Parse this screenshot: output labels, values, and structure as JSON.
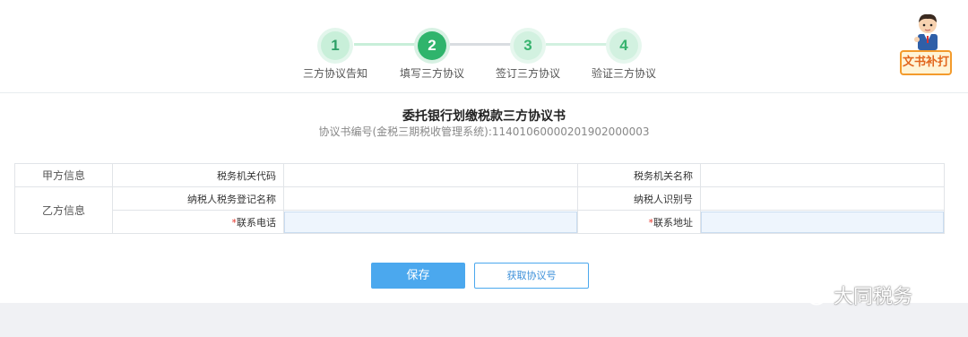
{
  "stepper": {
    "steps": [
      {
        "num": "1",
        "label": "三方协议告知",
        "state": "done"
      },
      {
        "num": "2",
        "label": "填写三方协议",
        "state": "active"
      },
      {
        "num": "3",
        "label": "签订三方协议",
        "state": "todo"
      },
      {
        "num": "4",
        "label": "验证三方协议",
        "state": "todo"
      }
    ],
    "colors": {
      "active": "#2fb46c",
      "line_done": "#c8efd9",
      "line_active": "#d9dde1"
    }
  },
  "mascot": {
    "badge_text": "文书补打",
    "icon": "assistant-avatar-icon"
  },
  "document": {
    "title": "委托银行划缴税款三方协议书",
    "subtitle": "协议书编号(金税三期税收管理系统):11401060000201902000003"
  },
  "form": {
    "party_a": "甲方信息",
    "party_b": "乙方信息",
    "tax_office_code_label": "税务机关代码",
    "tax_office_name_label": "税务机关名称",
    "taxpayer_reg_name_label": "纳税人税务登记名称",
    "taxpayer_id_label": "纳税人识别号",
    "required_mark": "*",
    "phone_label": "联系电话",
    "address_label": "联系地址",
    "values": {
      "tax_office_code": "",
      "tax_office_name": "",
      "taxpayer_reg_name": "",
      "taxpayer_id": "",
      "phone": "",
      "address": ""
    }
  },
  "buttons": {
    "save": "保存",
    "get_agreement_no": "获取协议号"
  },
  "watermark": {
    "text": "大同税务",
    "icon": "wechat-icon"
  }
}
